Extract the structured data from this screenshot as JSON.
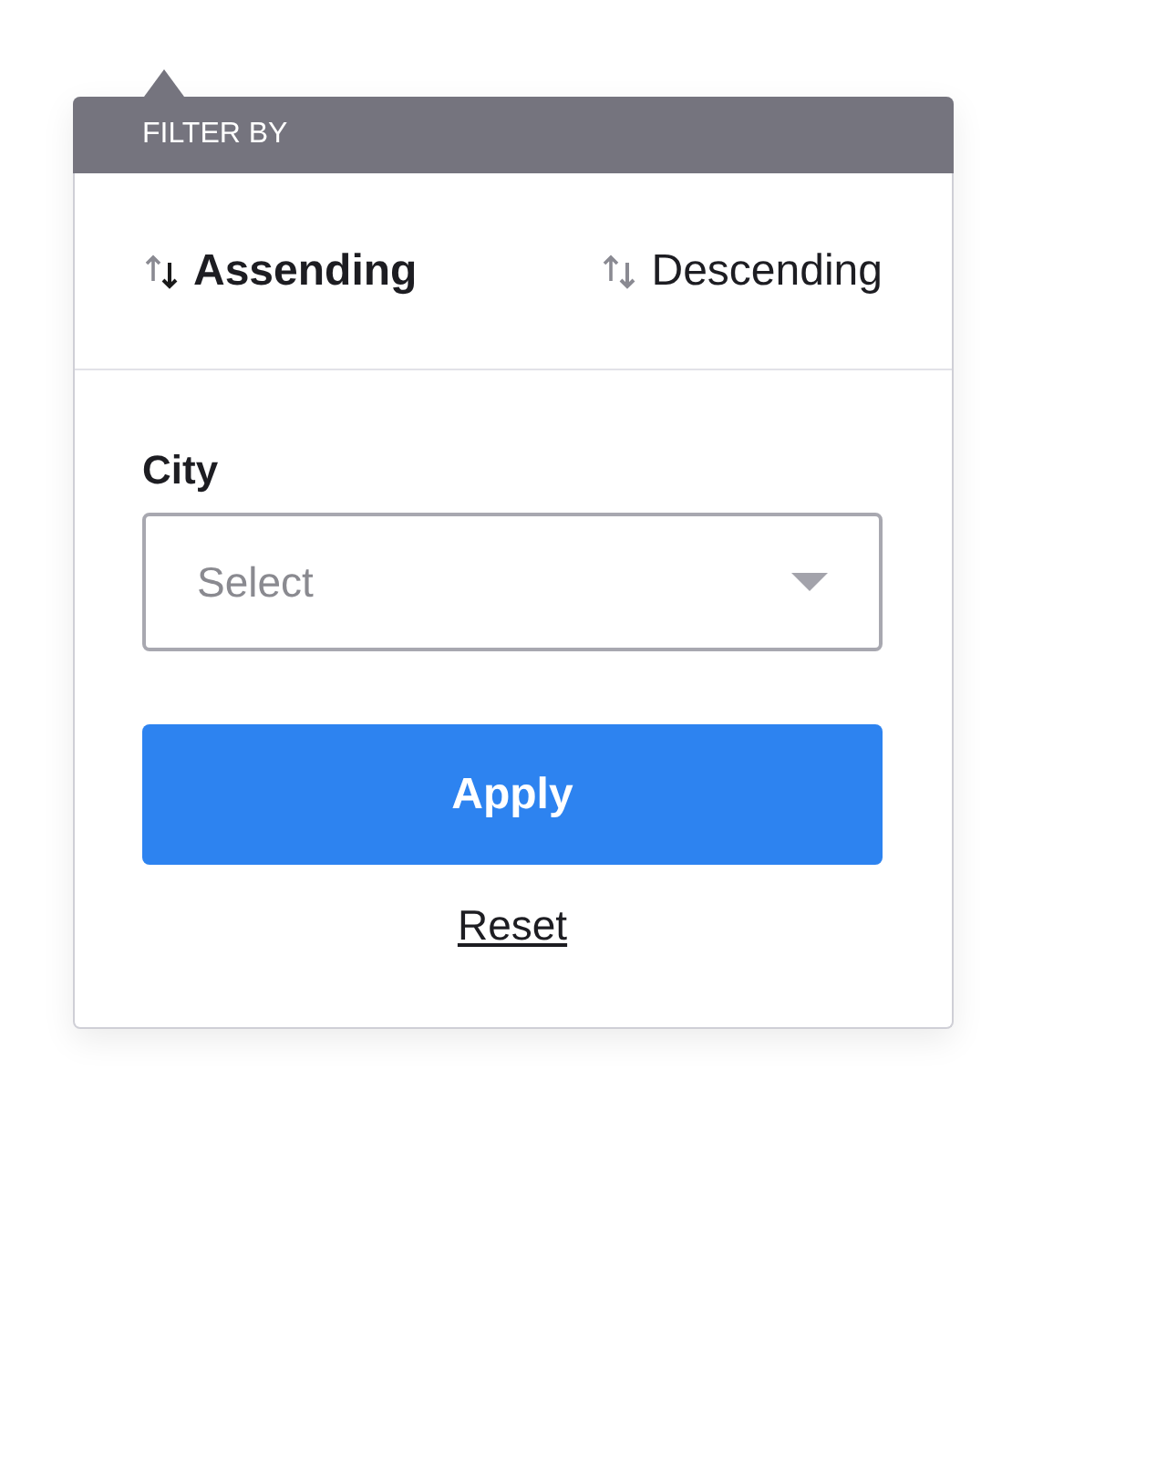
{
  "popover": {
    "title": "FILTER BY"
  },
  "sort_options": [
    {
      "label": "Assending",
      "selected": true
    },
    {
      "label": "Descending",
      "selected": false
    }
  ],
  "city": {
    "label": "City",
    "placeholder": "Select"
  },
  "apply_button": "Apply",
  "reset_link": "Reset"
}
